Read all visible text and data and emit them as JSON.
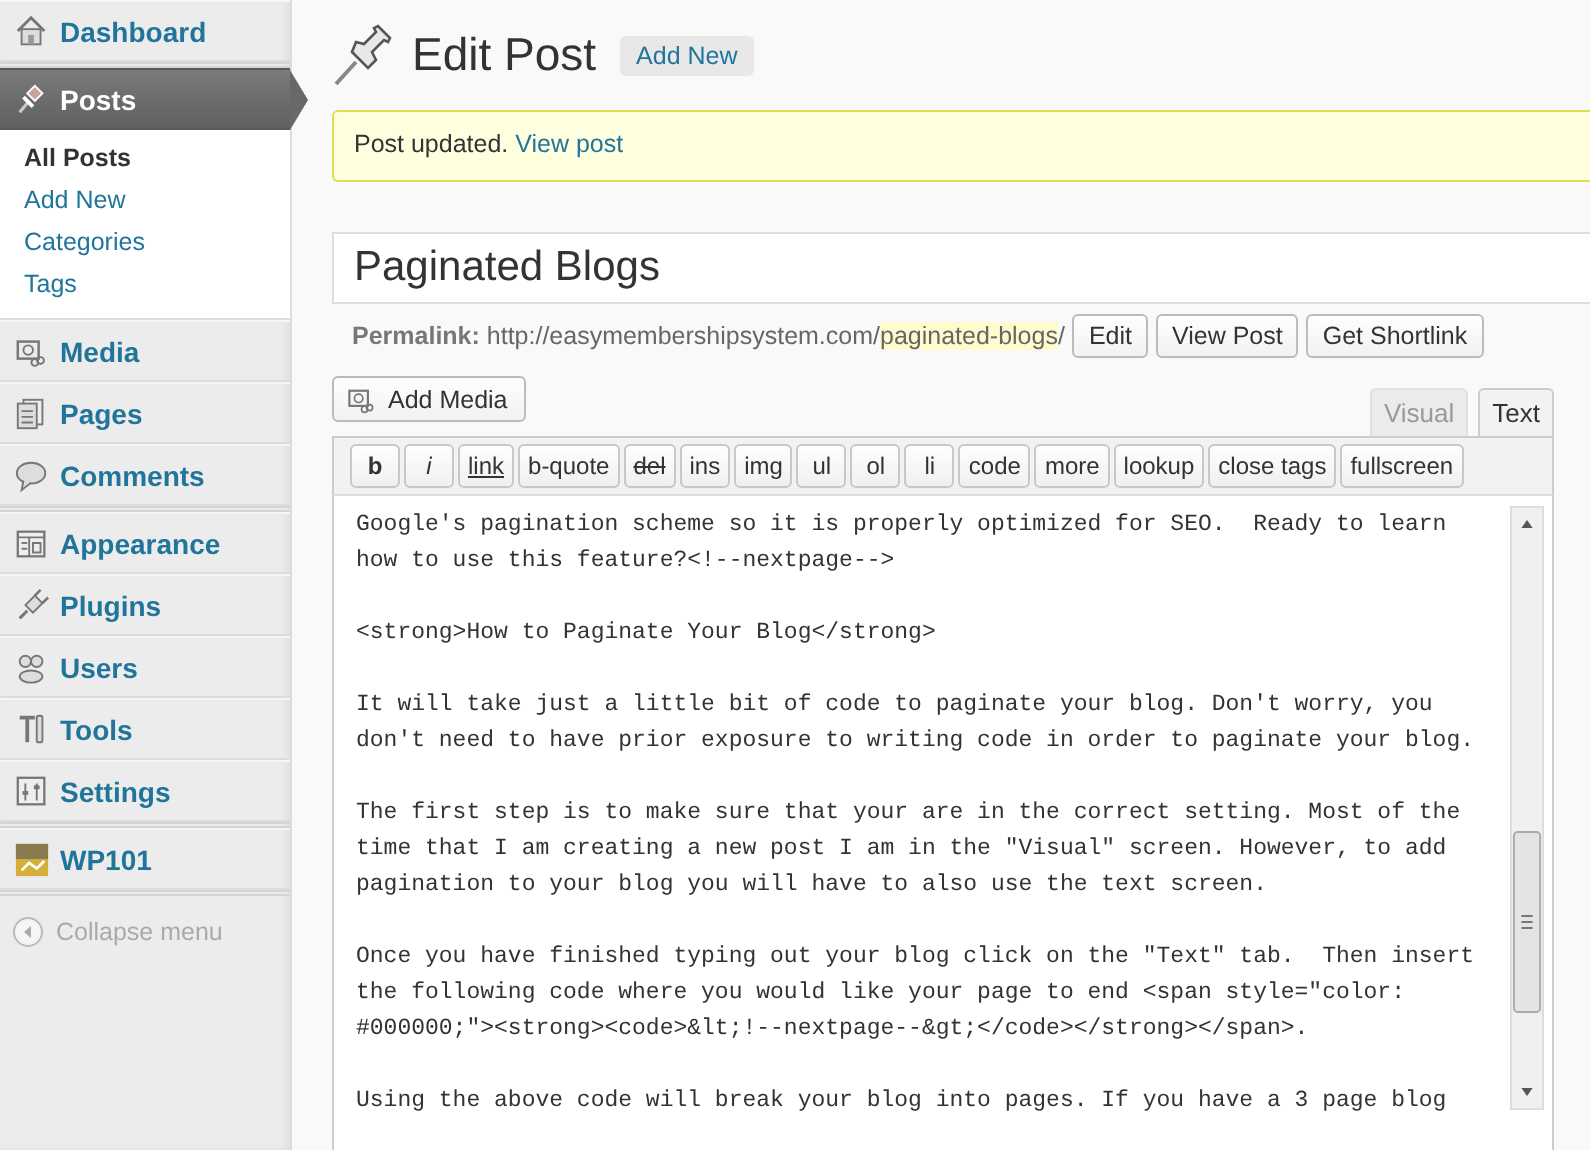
{
  "sidebar": {
    "groups": [
      {
        "items": [
          {
            "label": "Dashboard",
            "selected": false
          }
        ]
      },
      {
        "items": [
          {
            "label": "Posts",
            "selected": true,
            "children": [
              {
                "label": "All Posts",
                "selected": true
              },
              {
                "label": "Add New",
                "selected": false
              },
              {
                "label": "Categories",
                "selected": false
              },
              {
                "label": "Tags",
                "selected": false
              }
            ]
          },
          {
            "label": "Media",
            "selected": false
          },
          {
            "label": "Pages",
            "selected": false
          },
          {
            "label": "Comments",
            "selected": false
          }
        ]
      },
      {
        "items": [
          {
            "label": "Appearance",
            "selected": false
          },
          {
            "label": "Plugins",
            "selected": false
          },
          {
            "label": "Users",
            "selected": false
          },
          {
            "label": "Tools",
            "selected": false
          },
          {
            "label": "Settings",
            "selected": false
          }
        ]
      },
      {
        "items": [
          {
            "label": "WP101",
            "selected": false
          }
        ]
      }
    ],
    "collapse": "Collapse menu"
  },
  "header": {
    "title": "Edit Post",
    "add_new": "Add New"
  },
  "notice": {
    "text": "Post updated.",
    "link": "View post"
  },
  "post": {
    "title": "Paginated Blogs",
    "permalink": {
      "label": "Permalink:",
      "base": "http://easymembershipsystem.com/",
      "slug": "paginated-blogs",
      "tail": "/",
      "buttons": [
        "Edit",
        "View Post",
        "Get Shortlink"
      ]
    }
  },
  "editor": {
    "add_media": "Add Media",
    "tabs": [
      {
        "label": "Visual",
        "selected": false
      },
      {
        "label": "Text",
        "selected": true
      }
    ],
    "toolbar": [
      "b",
      "i",
      "link",
      "b-quote",
      "del",
      "ins",
      "img",
      "ul",
      "ol",
      "li",
      "code",
      "more",
      "lookup",
      "close tags",
      "fullscreen"
    ],
    "paragraphs": [
      [
        "Google's pagination scheme so it is properly optimized for SEO.  Ready to learn",
        "how to use this feature?<!--nextpage-->"
      ],
      [
        "<strong>How to Paginate Your Blog</strong>"
      ],
      [
        "It will take just a little bit of code to paginate your blog. Don't worry, you",
        "don't need to have prior exposure to writing code in order to paginate your blog."
      ],
      [
        "The first step is to make sure that your are in the correct setting. Most of the",
        "time that I am creating a new post I am in the \"Visual\" screen. However, to add",
        "pagination to your blog you will have to also use the text screen."
      ],
      [
        "Once you have finished typing out your blog click on the \"Text\" tab.  Then insert",
        "the following code where you would like your page to end <span style=\"color:",
        "#000000;\"><strong><code>&lt;!--nextpage--&gt;</code></strong></span>."
      ],
      [
        "Using the above code will break your blog into pages. If you have a 3 page blog"
      ]
    ]
  }
}
